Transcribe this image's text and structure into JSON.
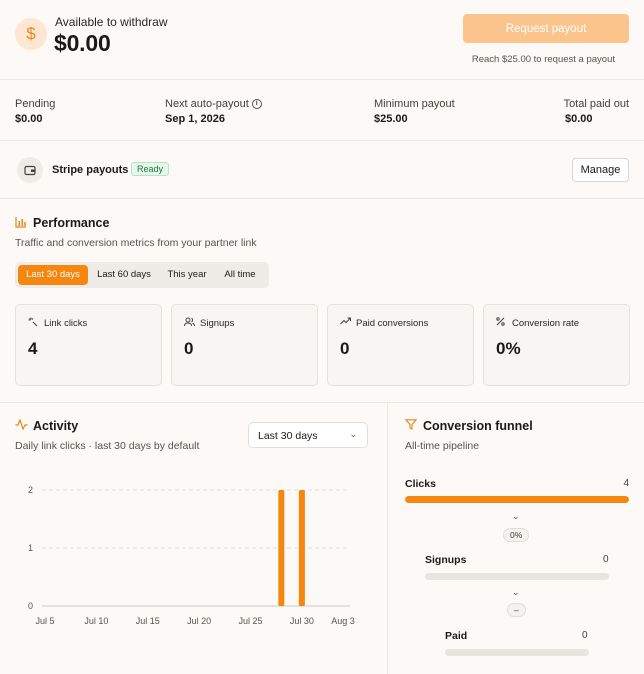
{
  "balance": {
    "label": "Available to withdraw",
    "currency_icon": "dollar-icon",
    "amount": "$0.00",
    "request_button": "Request payout",
    "hint": "Reach $25.00 to request a payout"
  },
  "stats": [
    {
      "label": "Pending",
      "value": "$0.00"
    },
    {
      "label": "Next auto-payout",
      "value": "Sep 1, 2026",
      "icon": "info-icon"
    },
    {
      "label": "Minimum payout",
      "value": "$25.00"
    },
    {
      "label": "Total paid out",
      "value": "$0.00"
    }
  ],
  "stripe": {
    "icon": "wallet-icon",
    "label": "Stripe payouts",
    "status": "Ready",
    "manage_button": "Manage"
  },
  "performance": {
    "icon": "bar-chart-icon",
    "title": "Performance",
    "subtitle": "Traffic and conversion metrics from your partner link",
    "ranges": [
      "Last 30 days",
      "Last 60 days",
      "This year",
      "All time"
    ],
    "active_range": "Last 30 days",
    "metrics": [
      {
        "icon": "sparkle-click-icon",
        "label": "Link clicks",
        "value": "4"
      },
      {
        "icon": "users-icon",
        "label": "Signups",
        "value": "0"
      },
      {
        "icon": "trending-up-icon",
        "label": "Paid conversions",
        "value": "0"
      },
      {
        "icon": "percent-icon",
        "label": "Conversion rate",
        "value": "0%"
      }
    ]
  },
  "activity": {
    "icon": "activity-icon",
    "title": "Activity",
    "subtitle": "Daily link clicks · last 30 days by default",
    "dropdown_value": "Last 30 days"
  },
  "chart_data": {
    "type": "bar",
    "x_ticks": [
      "Jul 5",
      "Jul 10",
      "Jul 15",
      "Jul 20",
      "Jul 25",
      "Jul 30",
      "Aug 3"
    ],
    "y_ticks": [
      "0",
      "1",
      "2"
    ],
    "ylim": [
      0,
      2
    ],
    "x_start": "Jul 5",
    "x_end": "Aug 3",
    "points": [
      {
        "date": "Jul 28",
        "value": 2
      },
      {
        "date": "Jul 30",
        "value": 2
      }
    ],
    "grid": true,
    "color": "#f5860f"
  },
  "funnel": {
    "icon": "filter-icon",
    "title": "Conversion funnel",
    "subtitle": "All-time pipeline",
    "stages": [
      {
        "label": "Clicks",
        "count": "4",
        "fill": 1.0
      },
      {
        "label": "Signups",
        "count": "0",
        "fill": 0.0
      },
      {
        "label": "Paid",
        "count": "0",
        "fill": 0.0
      }
    ],
    "rates": [
      "0%",
      "–"
    ]
  },
  "colors": {
    "accent": "#f5860f",
    "accent_light": "#fbc48d",
    "success": "#1f7a3f"
  }
}
